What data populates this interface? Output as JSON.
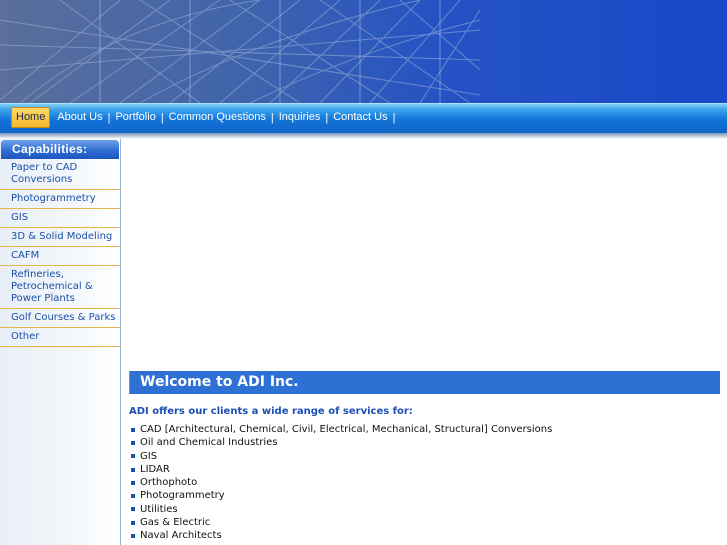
{
  "nav": {
    "items": [
      {
        "label": "Home",
        "active": true
      },
      {
        "label": "About Us",
        "active": false
      },
      {
        "label": "Portfolio",
        "active": false
      },
      {
        "label": "Common Questions",
        "active": false
      },
      {
        "label": "Inquiries",
        "active": false
      },
      {
        "label": "Contact Us",
        "active": false
      }
    ],
    "separator": "|"
  },
  "sidebar": {
    "heading": "Capabilities:",
    "items": [
      {
        "label": "Paper to CAD Conversions"
      },
      {
        "label": "Photogrammetry"
      },
      {
        "label": "GIS"
      },
      {
        "label": "3D & Solid Modeling"
      },
      {
        "label": "CAFM"
      },
      {
        "label": "Refineries, Petrochemical & Power Plants"
      },
      {
        "label": "Golf Courses & Parks"
      },
      {
        "label": "Other"
      }
    ]
  },
  "main": {
    "welcome_title": "Welcome to ADI Inc.",
    "intro": "ADI offers our clients a wide range of services for:",
    "services": [
      "CAD [Architectural, Chemical, Civil, Electrical, Mechanical, Structural] Conversions",
      "Oil and Chemical Industries",
      "GIS",
      "LIDAR",
      "Orthophoto",
      "Photogrammetry",
      "Utilities",
      "Gas & Electric",
      "Naval Architects"
    ]
  },
  "colors": {
    "banner_blue": "#2553c4",
    "nav_blue": "#1274d9",
    "active_tab": "#f3b82d",
    "heading_blue": "#2f70d4",
    "link_blue": "#1b4fa8",
    "divider_gold": "#e4b54c"
  }
}
